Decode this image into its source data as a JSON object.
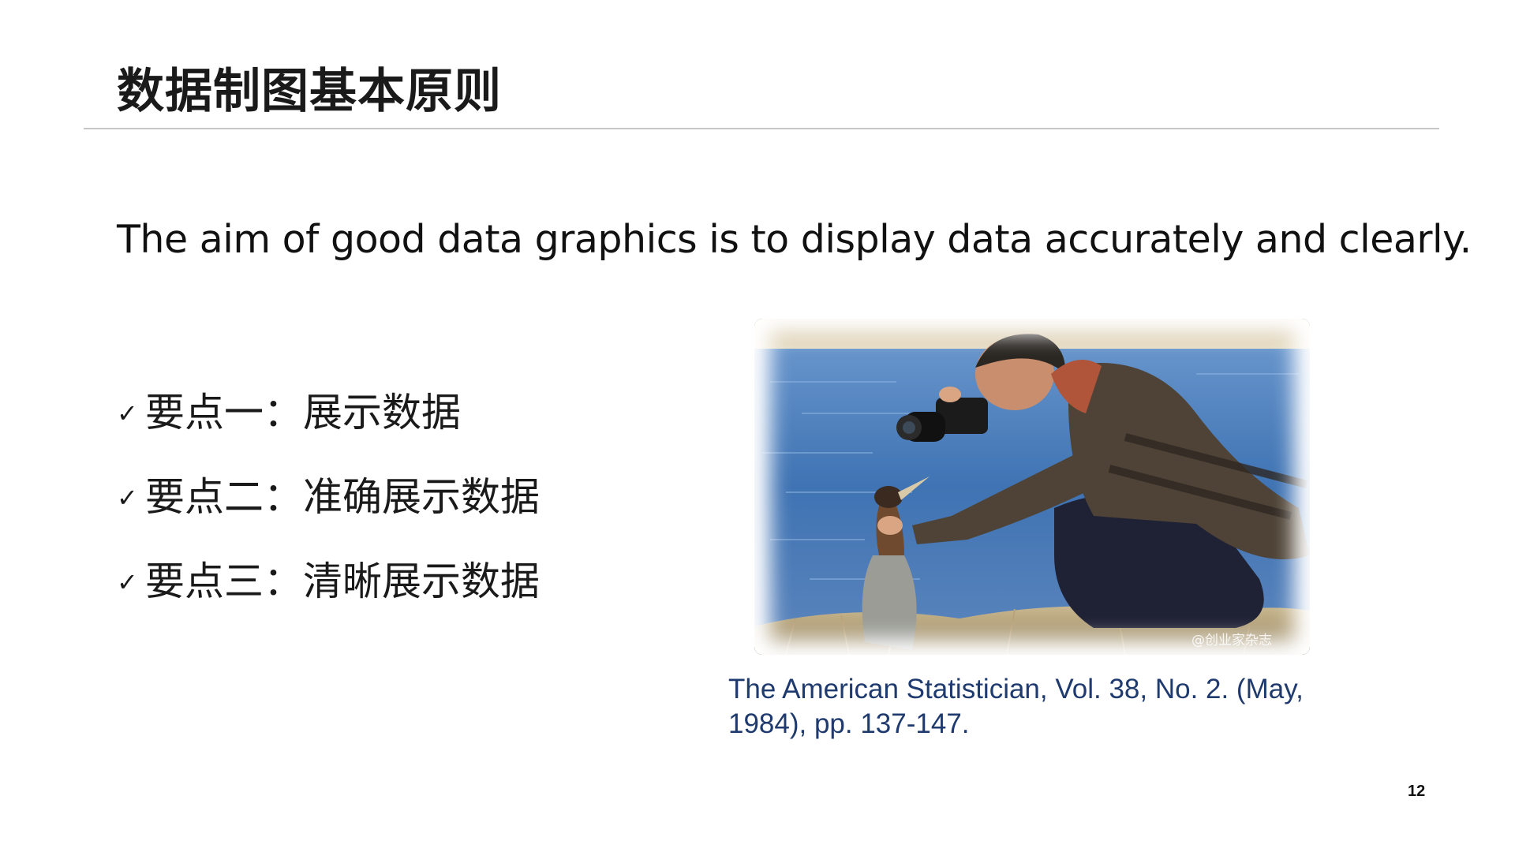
{
  "slide": {
    "title": "数据制图基本原则",
    "subtitle": "The aim of good data graphics is to display data accurately and clearly.",
    "points": [
      {
        "check": "✓",
        "label": "要点一：展示数据"
      },
      {
        "check": "✓",
        "label": "要点二：准确展示数据"
      },
      {
        "check": "✓",
        "label": "要点三：清晰展示数据"
      }
    ],
    "photo_watermark": "@创业家杂志",
    "caption": "The American Statistician, Vol. 38, No. 2. (May, 1984), pp. 137-147.",
    "page_number": "12"
  },
  "colors": {
    "title": "#1a1a1a",
    "caption": "#1f3a6e",
    "rule": "#c7c7c7",
    "water": "#3f73b3"
  }
}
